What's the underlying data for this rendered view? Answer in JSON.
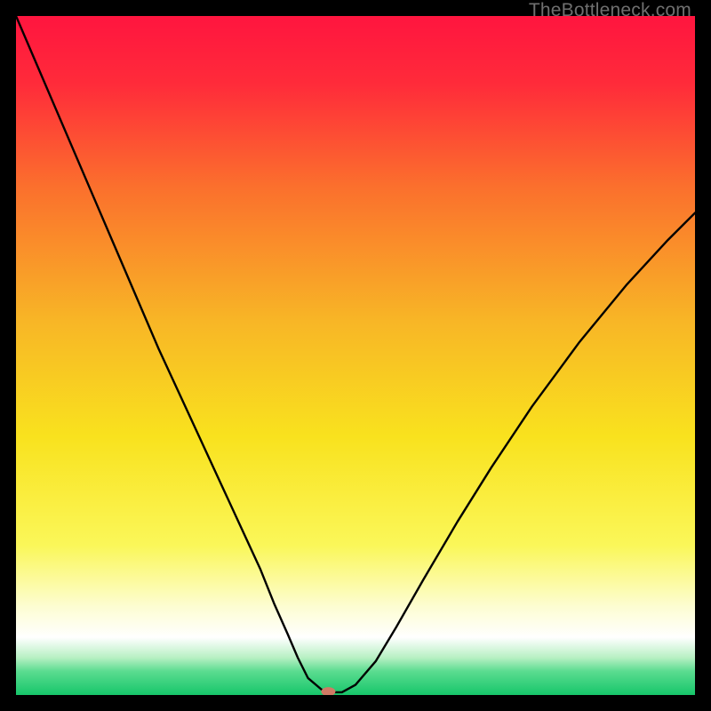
{
  "watermark": "TheBottleneck.com",
  "chart_data": {
    "type": "line",
    "title": "",
    "xlabel": "",
    "ylabel": "",
    "xlim": [
      0,
      100
    ],
    "ylim": [
      0,
      100
    ],
    "grid": false,
    "legend": false,
    "gradient_stops": [
      {
        "offset": 0.0,
        "color": "#ff153f"
      },
      {
        "offset": 0.1,
        "color": "#ff2b3a"
      },
      {
        "offset": 0.25,
        "color": "#fb6f2d"
      },
      {
        "offset": 0.45,
        "color": "#f8b626"
      },
      {
        "offset": 0.62,
        "color": "#f9e21e"
      },
      {
        "offset": 0.78,
        "color": "#faf759"
      },
      {
        "offset": 0.87,
        "color": "#fdfdd2"
      },
      {
        "offset": 0.915,
        "color": "#ffffff"
      },
      {
        "offset": 0.945,
        "color": "#b7f0c3"
      },
      {
        "offset": 0.965,
        "color": "#5bdc90"
      },
      {
        "offset": 1.0,
        "color": "#16c66a"
      }
    ],
    "series": [
      {
        "name": "bottleneck-curve",
        "type": "line",
        "x": [
          0.0,
          3.0,
          6.0,
          9.0,
          12.0,
          15.0,
          18.0,
          21.0,
          24.0,
          27.0,
          30.0,
          33.0,
          36.0,
          38.0,
          40.0,
          41.5,
          43.0,
          45.0,
          46.5,
          48.0,
          50.0,
          53.0,
          56.0,
          60.0,
          65.0,
          70.0,
          76.0,
          83.0,
          90.0,
          96.0,
          100.0
        ],
        "y": [
          100.0,
          93.0,
          86.0,
          79.0,
          72.0,
          65.0,
          58.0,
          51.0,
          44.5,
          38.0,
          31.5,
          25.0,
          18.5,
          13.5,
          9.0,
          5.5,
          2.5,
          0.8,
          0.4,
          0.4,
          1.5,
          5.0,
          10.0,
          17.0,
          25.5,
          33.5,
          42.5,
          52.0,
          60.5,
          67.0,
          71.0
        ]
      }
    ],
    "marker": {
      "x": 46.0,
      "y": 0.5,
      "color": "#d07a65",
      "rx": 8,
      "ry": 5
    }
  }
}
